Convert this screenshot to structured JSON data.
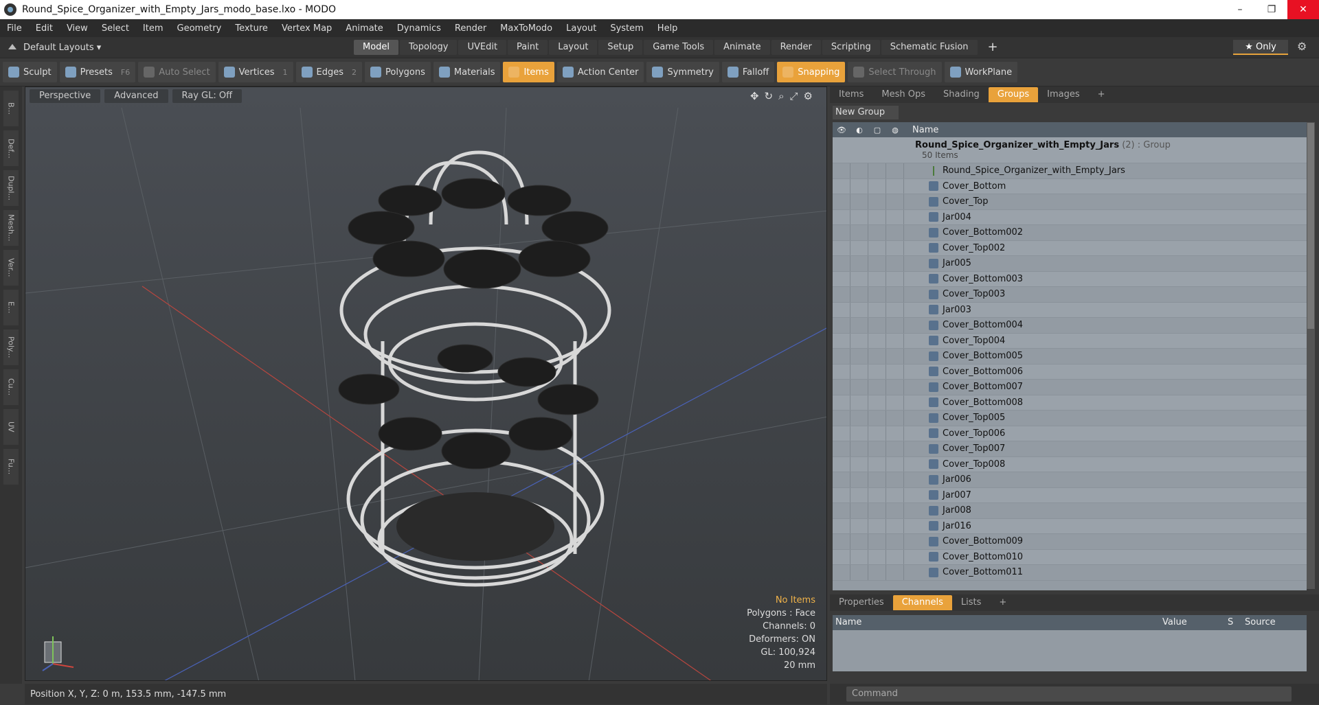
{
  "window": {
    "title": "Round_Spice_Organizer_with_Empty_Jars_modo_base.lxo - MODO",
    "minimize": "–",
    "restore": "❐",
    "close": "✕"
  },
  "menu": [
    "File",
    "Edit",
    "View",
    "Select",
    "Item",
    "Geometry",
    "Texture",
    "Vertex Map",
    "Animate",
    "Dynamics",
    "Render",
    "MaxToModo",
    "Layout",
    "System",
    "Help"
  ],
  "layout": {
    "default_label": "Default Layouts ▾",
    "only_label": "★ Only"
  },
  "tabs": [
    "Model",
    "Topology",
    "UVEdit",
    "Paint",
    "Layout",
    "Setup",
    "Game Tools",
    "Animate",
    "Render",
    "Scripting",
    "Schematic Fusion"
  ],
  "toolbar": {
    "sculpt": "Sculpt",
    "presets": "Presets",
    "presets_key": "F6",
    "auto_select": "Auto Select",
    "vertices": "Vertices",
    "vertices_n": "1",
    "edges": "Edges",
    "edges_n": "2",
    "polygons": "Polygons",
    "materials": "Materials",
    "items": "Items",
    "action_center": "Action Center",
    "symmetry": "Symmetry",
    "falloff": "Falloff",
    "snapping": "Snapping",
    "select_through": "Select Through",
    "workplane": "WorkPlane"
  },
  "leftstrip": [
    "B...",
    "Def...",
    "Dupl...",
    "Mesh...",
    "Ver...",
    "E...",
    "Poly...",
    "Cu...",
    "UV",
    "Fu..."
  ],
  "viewport": {
    "perspective": "Perspective",
    "advanced": "Advanced",
    "raygl": "Ray GL: Off",
    "stats": {
      "no_items": "No Items",
      "polygons": "Polygons : Face",
      "channels": "Channels: 0",
      "deformers": "Deformers: ON",
      "gl": "GL: 100,924",
      "scale": "20 mm"
    }
  },
  "statusbar": {
    "position": "Position X, Y, Z:   0 m, 153.5 mm, -147.5 mm"
  },
  "rightpanel": {
    "tabs": [
      "Items",
      "Mesh Ops",
      "Shading",
      "Groups",
      "Images",
      "+"
    ],
    "new_group": "New Group",
    "name_header": "Name",
    "group": {
      "name": "Round_Spice_Organizer_with_Empty_Jars",
      "suffix": " (2) : Group",
      "count": "50 Items"
    },
    "items": [
      "Round_Spice_Organizer_with_Empty_Jars",
      "Cover_Bottom",
      "Cover_Top",
      "Jar004",
      "Cover_Bottom002",
      "Cover_Top002",
      "Jar005",
      "Cover_Bottom003",
      "Cover_Top003",
      "Jar003",
      "Cover_Bottom004",
      "Cover_Top004",
      "Cover_Bottom005",
      "Cover_Bottom006",
      "Cover_Bottom007",
      "Cover_Bottom008",
      "Cover_Top005",
      "Cover_Top006",
      "Cover_Top007",
      "Cover_Top008",
      "Jar006",
      "Jar007",
      "Jar008",
      "Jar016",
      "Cover_Bottom009",
      "Cover_Bottom010",
      "Cover_Bottom011"
    ]
  },
  "bottompanel": {
    "tabs": [
      "Properties",
      "Channels",
      "Lists",
      "+"
    ],
    "columns": {
      "name": "Name",
      "value": "Value",
      "s": "S",
      "source": "Source"
    }
  },
  "command": {
    "placeholder": "Command"
  }
}
